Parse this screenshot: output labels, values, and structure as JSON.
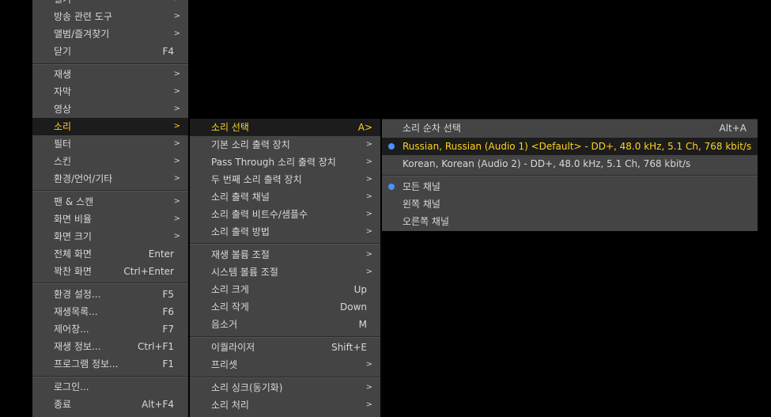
{
  "main_menu": {
    "items": [
      {
        "label": "열기",
        "arrow": ">"
      },
      {
        "label": "방송 관련 도구",
        "arrow": ">"
      },
      {
        "label": "앨범/즐겨찾기",
        "arrow": ">"
      },
      {
        "label": "닫기",
        "shortcut": "F4"
      },
      {
        "label": "재생",
        "arrow": ">"
      },
      {
        "label": "자막",
        "arrow": ">"
      },
      {
        "label": "영상",
        "arrow": ">"
      },
      {
        "label": "소리",
        "arrow": ">"
      },
      {
        "label": "필터",
        "arrow": ">"
      },
      {
        "label": "스킨",
        "arrow": ">"
      },
      {
        "label": "환경/언어/기타",
        "arrow": ">"
      },
      {
        "label": "팬 & 스캔",
        "arrow": ">"
      },
      {
        "label": "화면 비율",
        "arrow": ">"
      },
      {
        "label": "화면 크기",
        "arrow": ">"
      },
      {
        "label": "전체 화면",
        "shortcut": "Enter"
      },
      {
        "label": "꽉찬 화면",
        "shortcut": "Ctrl+Enter"
      },
      {
        "label": "환경 설정...",
        "shortcut": "F5"
      },
      {
        "label": "재생목록...",
        "shortcut": "F6"
      },
      {
        "label": "제어창...",
        "shortcut": "F7"
      },
      {
        "label": "재생 정보...",
        "shortcut": "Ctrl+F1"
      },
      {
        "label": "프로그램 정보...",
        "shortcut": "F1"
      },
      {
        "label": "로그인...",
        "shortcut": ""
      },
      {
        "label": "종료",
        "shortcut": "Alt+F4"
      }
    ]
  },
  "sound_menu": {
    "items": [
      {
        "label": "소리 선택",
        "shortcut": "A",
        "arrow": ">"
      },
      {
        "label": "기본 소리 출력 장치",
        "arrow": ">"
      },
      {
        "label": "Pass Through 소리 출력 장치",
        "arrow": ">"
      },
      {
        "label": "두 번째 소리 출력 장치",
        "arrow": ">"
      },
      {
        "label": "소리 출력 채널",
        "arrow": ">"
      },
      {
        "label": "소리 출력 비트수/샘플수",
        "arrow": ">"
      },
      {
        "label": "소리 출력 방법",
        "arrow": ">"
      },
      {
        "label": "재생 볼륨 조절",
        "arrow": ">"
      },
      {
        "label": "시스템 볼륨 조절",
        "arrow": ">"
      },
      {
        "label": "소리 크게",
        "shortcut": "Up"
      },
      {
        "label": "소리 작게",
        "shortcut": "Down"
      },
      {
        "label": "음소거",
        "shortcut": "M"
      },
      {
        "label": "이퀄라이저",
        "shortcut": "Shift+E"
      },
      {
        "label": "프리셋",
        "arrow": ">"
      },
      {
        "label": "소리 싱크(동기화)",
        "arrow": ">"
      },
      {
        "label": "소리 처리",
        "arrow": ">"
      }
    ]
  },
  "audio_menu": {
    "items": [
      {
        "label": "소리 순차 선택",
        "shortcut": "Alt+A"
      },
      {
        "label": "Russian, Russian (Audio 1) <Default> - DD+, 48.0 kHz, 5.1 Ch, 768 kbit/s"
      },
      {
        "label": "Korean, Korean (Audio 2) - DD+, 48.0 kHz, 5.1 Ch, 768 kbit/s"
      },
      {
        "label": "모든 채널"
      },
      {
        "label": "왼쪽 채널"
      },
      {
        "label": "오른쪽 채널"
      }
    ]
  },
  "colors": {
    "background": "#000000",
    "menu_bg": "#444444",
    "active_bg": "#1c1c1c",
    "active_text": "#ffd21f",
    "radio": "#4a90ff"
  },
  "icons": {
    "submenu_arrow": "chevron-right-icon",
    "radio_selected": "radio-dot-icon"
  }
}
